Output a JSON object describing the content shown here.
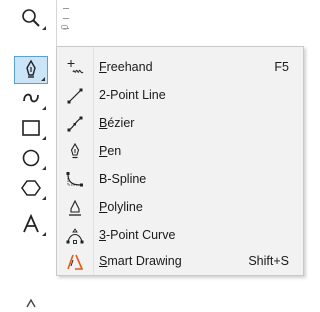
{
  "toolbox": {
    "ruler_number": "0",
    "tools": [
      {
        "name": "zoom-tool",
        "icon": "magnifier-icon"
      },
      {
        "name": "curve-tool",
        "icon": "pen-nib-icon",
        "selected": true
      },
      {
        "name": "artistic-media-tool",
        "icon": "artistic-curve-icon"
      },
      {
        "name": "rectangle-tool",
        "icon": "rectangle-icon"
      },
      {
        "name": "ellipse-tool",
        "icon": "ellipse-icon"
      },
      {
        "name": "polygon-tool",
        "icon": "polygon-icon"
      },
      {
        "name": "text-tool",
        "icon": "text-a-icon"
      }
    ]
  },
  "menu": {
    "items": [
      {
        "pre": "",
        "mnemonic": "F",
        "post": "reehand",
        "shortcut": "F5",
        "icon": "freehand-icon"
      },
      {
        "pre": "2-Point Line",
        "mnemonic": "",
        "post": "",
        "shortcut": "",
        "icon": "two-point-line-icon"
      },
      {
        "pre": "",
        "mnemonic": "B",
        "post": "ézier",
        "shortcut": "",
        "icon": "bezier-icon"
      },
      {
        "pre": "",
        "mnemonic": "P",
        "post": "en",
        "shortcut": "",
        "icon": "pen-icon"
      },
      {
        "pre": "B-Spline",
        "mnemonic": "",
        "post": "",
        "shortcut": "",
        "icon": "b-spline-icon"
      },
      {
        "pre": "",
        "mnemonic": "P",
        "post": "olyline",
        "shortcut": "",
        "icon": "polyline-icon"
      },
      {
        "pre": "",
        "mnemonic": "3",
        "post": "-Point Curve",
        "shortcut": "",
        "icon": "three-point-curve-icon"
      },
      {
        "pre": "",
        "mnemonic": "S",
        "post": "mart Drawing",
        "shortcut": "Shift+S",
        "icon": "smart-drawing-icon"
      }
    ]
  },
  "colors": {
    "selected_bg": "#cce4f7",
    "selected_border": "#5aa0d8",
    "smart_drawing_accent": "#e05a1a"
  }
}
